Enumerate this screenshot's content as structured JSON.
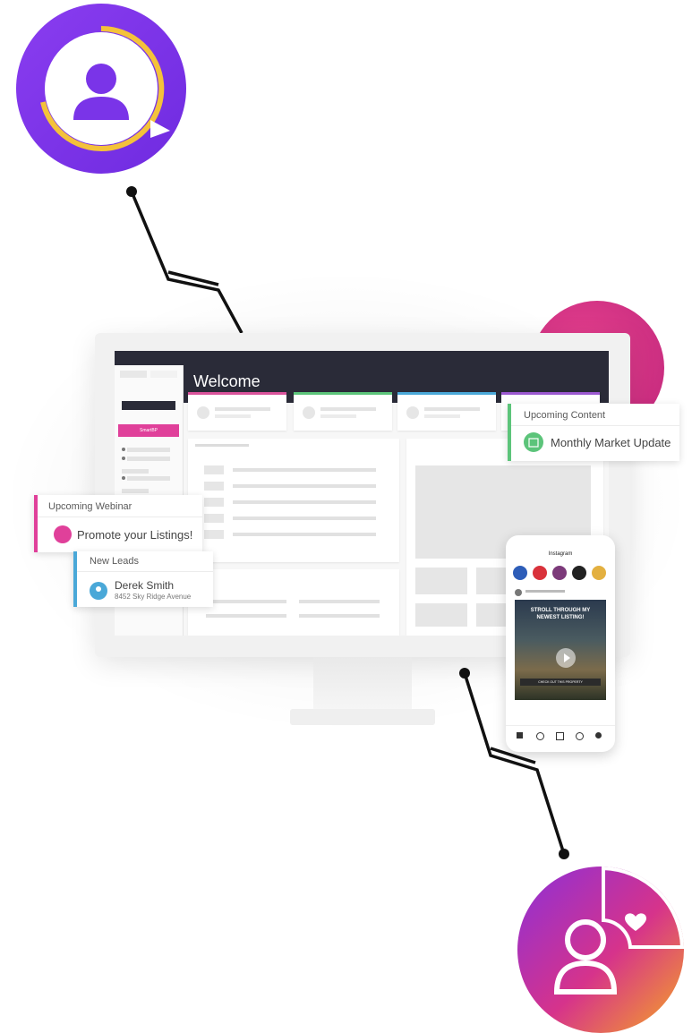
{
  "dashboard": {
    "welcome": "Welcome",
    "pink_button": "SmartBP"
  },
  "cards": {
    "upcoming_content": {
      "title": "Upcoming Content",
      "item": "Monthly Market Update"
    },
    "upcoming_webinar": {
      "title": "Upcoming Webinar",
      "item": "Promote your Listings!"
    },
    "new_leads": {
      "title": "New Leads",
      "name": "Derek Smith",
      "address": "8452 Sky Ridge Avenue"
    }
  },
  "phone": {
    "app_title": "Instagram",
    "post_headline": "STROLL THROUGH MY NEWEST LISTING!",
    "cta": "CHECK OUT THIS PROPERTY"
  },
  "colors": {
    "purple": "#7a34e8",
    "pink": "#e0409a",
    "green": "#5cc47a",
    "blue": "#4aa8d8",
    "dark": "#2a2b38"
  },
  "icons": [
    "user-chat-icon",
    "user-heart-icon",
    "play-icon"
  ]
}
